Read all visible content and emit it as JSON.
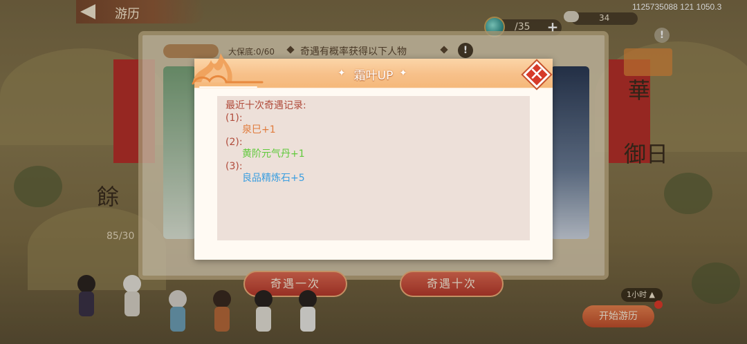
{
  "topbar": {
    "tab_title": "游历",
    "coords": "1125735088 121 1050.3"
  },
  "resources": {
    "gem_count": "/35",
    "cloud_count": "34"
  },
  "underlying_panel": {
    "header": "奇遇有概率获得以下人物",
    "guarantee": "大保底:0/60",
    "side_count": "85/30",
    "calli_left": "餘",
    "calli_right": "御日",
    "calli_top": "華",
    "buttons": {
      "once": "奇遇一次",
      "ten": "奇遇十次"
    },
    "duration": "1小时",
    "start": "开始游历"
  },
  "dialog": {
    "title": "霜叶UP",
    "log_title": "最近十次奇遇记录:",
    "entries": [
      {
        "index": "(1):",
        "item": "泉巳+1",
        "color": "#e07a3a"
      },
      {
        "index": "(2):",
        "item": "黄阶元气丹+1",
        "color": "#5fc93a"
      },
      {
        "index": "(3):",
        "item": "良品精炼石+5",
        "color": "#3a9ee0"
      }
    ],
    "colors": {
      "header": "#f7c089",
      "body": "#ede0d9",
      "close": "#d63b2a"
    }
  },
  "icons": {
    "back": "back-arrow-icon",
    "close": "close-icon",
    "gem": "gem-icon",
    "info": "info-icon",
    "warn": "warning-icon"
  }
}
